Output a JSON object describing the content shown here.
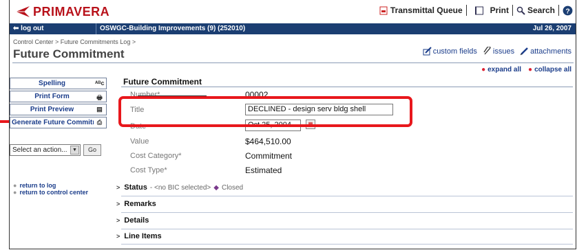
{
  "brand": {
    "name": "PRIMAVERA"
  },
  "toolbar": {
    "transmittal_queue": "Transmittal Queue",
    "print": "Print",
    "search": "Search",
    "help_icon": "help-icon"
  },
  "navbar": {
    "logout": "log out",
    "project": "OSWGC-Building Improvements (9) (252010)",
    "date": "Jul 26, 2007"
  },
  "breadcrumb": "Control Center > Future Commitments Log >",
  "page_title": "Future Commitment",
  "header_links": {
    "custom_fields": "custom fields",
    "issues": "issues",
    "attachments": "attachments"
  },
  "expand_all": "expand all",
  "collapse_all": "collapse all",
  "sidebar": {
    "buttons": [
      {
        "label": "Spelling",
        "icon": "spellcheck-icon"
      },
      {
        "label": "Print Form",
        "icon": "printer-icon"
      },
      {
        "label": "Print Preview",
        "icon": "document-icon"
      },
      {
        "label": "Generate Future Commitment",
        "icon": "generate-icon"
      }
    ],
    "action_select": "Select an action...",
    "go": "Go",
    "links": [
      "return to log",
      "return to control center"
    ]
  },
  "form": {
    "section_title": "Future Commitment",
    "fields": {
      "number_label": "Number*",
      "number_value": "00002",
      "title_label": "Title",
      "title_value": "DECLINED - design serv bldg shell",
      "date_label": "Date",
      "date_value": "Oct 25, 2004",
      "value_label": "Value",
      "value_value": "$464,510.00",
      "cost_category_label": "Cost Category*",
      "cost_category_value": "Commitment",
      "cost_type_label": "Cost Type*",
      "cost_type_value": "Estimated"
    }
  },
  "sections": {
    "status": {
      "label": "Status",
      "extra": "- <no BIC selected>",
      "state": "Closed"
    },
    "remarks": "Remarks",
    "details": "Details",
    "line_items": "Line Items"
  },
  "colors": {
    "accent_red": "#e8171c",
    "nav_blue": "#1b3e72",
    "link_blue": "#1a3c8a"
  }
}
